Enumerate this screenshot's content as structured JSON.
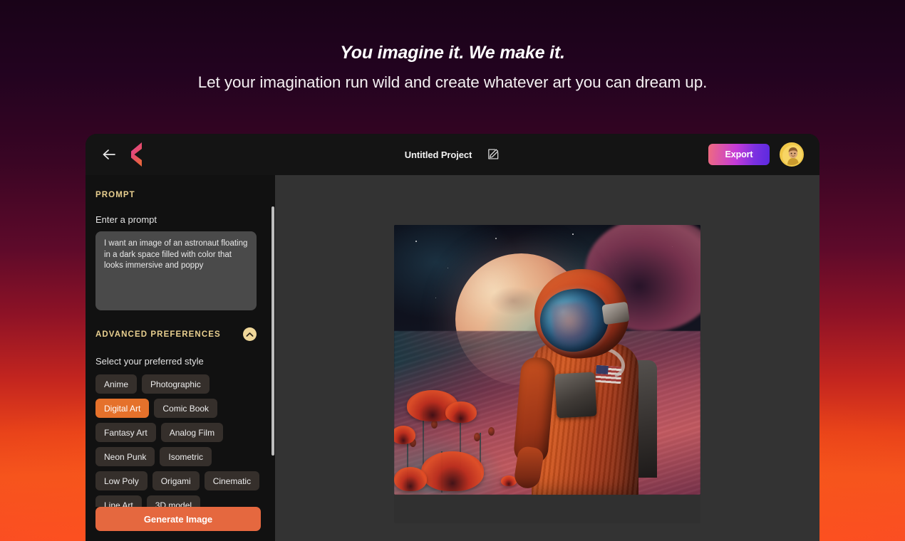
{
  "hero": {
    "title": "You imagine it. We make it.",
    "subtitle": "Let your imagination run wild and create whatever art you can dream up."
  },
  "topbar": {
    "back_icon": "arrow-left-icon",
    "logo_icon": "brand-logo-icon",
    "project_title": "Untitled Project",
    "edit_icon": "edit-pencil-square-icon",
    "export_label": "Export",
    "avatar_label": "user-avatar"
  },
  "sidebar": {
    "prompt_section_label": "PROMPT",
    "prompt_field_label": "Enter a prompt",
    "prompt_value": "I want an image of an astronaut floating in a dark space filled with color that looks immersive and poppy",
    "prompt_placeholder": "Enter a prompt",
    "advanced_section_label": "ADVANCED PREFERENCES",
    "collapse_icon": "chevron-up-icon",
    "style_field_label": "Select your preferred style",
    "styles": [
      {
        "label": "Anime",
        "selected": false
      },
      {
        "label": "Photographic",
        "selected": false
      },
      {
        "label": "Digital Art",
        "selected": true
      },
      {
        "label": "Comic Book",
        "selected": false
      },
      {
        "label": "Fantasy Art",
        "selected": false
      },
      {
        "label": "Analog Film",
        "selected": false
      },
      {
        "label": "Neon Punk",
        "selected": false
      },
      {
        "label": "Isometric",
        "selected": false
      },
      {
        "label": "Low Poly",
        "selected": false
      },
      {
        "label": "Origami",
        "selected": false
      },
      {
        "label": "Cinematic",
        "selected": false
      },
      {
        "label": "Line Art",
        "selected": false
      },
      {
        "label": "3D model",
        "selected": false
      }
    ],
    "generate_label": "Generate Image"
  },
  "canvas": {
    "image_alt": "Digital art of an astronaut in an orange spacesuit standing on a colorful alien landscape with red poppies and a large moon"
  },
  "colors": {
    "accent_orange": "#e5712b",
    "generate_button": "#e5683f",
    "section_label_gold": "#e8cf8f",
    "export_gradient_start": "#ef6b7f",
    "export_gradient_end": "#5b2ae0",
    "app_background": "#121212",
    "sidebar_background": "#111111",
    "canvas_background": "#333333",
    "chip_background": "#352f2b",
    "prompt_background": "#4a4a4a"
  }
}
